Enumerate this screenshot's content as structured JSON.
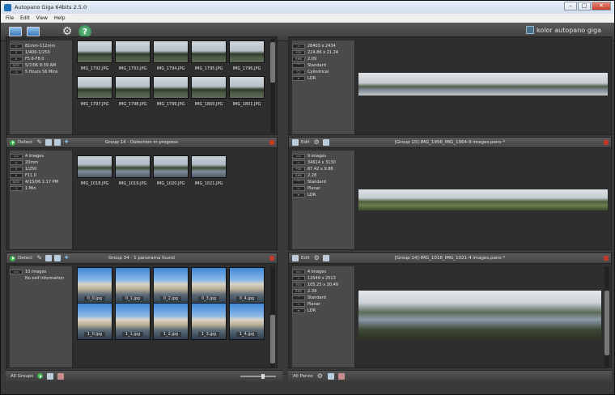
{
  "window": {
    "title": "Autopano Giga 64bits 2.5.0",
    "minimize": "–",
    "maximize": "□",
    "close": "✕"
  },
  "menu": [
    "File",
    "Edit",
    "View",
    "Help"
  ],
  "brand": "kolor autopano giga",
  "groups": [
    {
      "title": "",
      "info": [
        {
          "badge": "▭",
          "text": "81mm-112mm"
        },
        {
          "badge": "S",
          "text": "1/400-1/250"
        },
        {
          "badge": "A",
          "text": "F5.6-F8.0"
        },
        {
          "badge": "DATE",
          "text": "5/7/06 9:39 AM"
        },
        {
          "badge": "◷",
          "text": "5 Hours 56 Mins"
        }
      ],
      "thumbnails": [
        "IMG_1792.JPG",
        "IMG_1793.JPG",
        "IMG_1794.JPG",
        "IMG_1795.JPG",
        "IMG_1796.JPG",
        "IMG_1797.JPG",
        "IMG_1798.JPG",
        "IMG_1799.JPG",
        "IMG_1800.JPG",
        "IMG_1801.JPG"
      ]
    },
    {
      "title": "Group 14 - Detection in progress",
      "detect_label": "Detect",
      "info": [
        {
          "badge": "▭▭",
          "text": "4 images"
        },
        {
          "badge": "▭",
          "text": "20mm"
        },
        {
          "badge": "S",
          "text": "1/250"
        },
        {
          "badge": "A",
          "text": "F11.0"
        },
        {
          "badge": "DATE",
          "text": "4/15/06 1:17 PM"
        },
        {
          "badge": "◷",
          "text": "1 Min"
        }
      ],
      "thumbnails": [
        "IMG_1018.JPG",
        "IMG_1019.JPG",
        "IMG_1020.JPG",
        "IMG_1021.JPG"
      ]
    },
    {
      "title": "Group 34 - 1 panorama found",
      "detect_label": "Detect",
      "info": [
        {
          "badge": "▭▭",
          "text": "10 images"
        },
        {
          "badge": "",
          "text": "No exif information"
        }
      ],
      "thumbnails": [
        "0_0.jpg",
        "0_1.jpg",
        "0_2.jpg",
        "0_3.jpg",
        "0_4.jpg",
        "1_0.jpg",
        "1_1.jpg",
        "1_2.jpg",
        "1_3.jpg",
        "1_4.jpg"
      ]
    }
  ],
  "panos": [
    {
      "title": "",
      "info": [
        {
          "badge": "▭",
          "text": "26403 x 2434"
        },
        {
          "badge": "FOV",
          "text": "224.86 x 21.24"
        },
        {
          "badge": "RMS",
          "text": "2.09"
        },
        {
          "badge": "⌒",
          "text": "Standard"
        },
        {
          "badge": "◯",
          "text": "Cylindrical"
        },
        {
          "badge": "≋",
          "text": "LDR"
        }
      ]
    },
    {
      "title": "[Group 15]-IMG_1956_IMG_1964-9 images.pano *",
      "edit_label": "Edit",
      "info": [
        {
          "badge": "▭▭",
          "text": "9 images"
        },
        {
          "badge": "▭",
          "text": "34614 x 3130"
        },
        {
          "badge": "FOV",
          "text": "87.42 x 9.88"
        },
        {
          "badge": "RMS",
          "text": "2.28"
        },
        {
          "badge": "⌒",
          "text": "Standard"
        },
        {
          "badge": "▭",
          "text": "Planar"
        },
        {
          "badge": "≋",
          "text": "LDR"
        }
      ]
    },
    {
      "title": "[Group 14]-IMG_1018_IMG_1021-4 images.pano *",
      "edit_label": "Edit",
      "info": [
        {
          "badge": "▭▭",
          "text": "4 images"
        },
        {
          "badge": "▭",
          "text": "12549 x 2513"
        },
        {
          "badge": "FOV",
          "text": "105.25 x 30.49"
        },
        {
          "badge": "RMS",
          "text": "2.39"
        },
        {
          "badge": "⌒",
          "text": "Standard"
        },
        {
          "badge": "▭",
          "text": "Planar"
        },
        {
          "badge": "≋",
          "text": "LDR"
        }
      ]
    }
  ],
  "left_bottom": {
    "label": "All Groups"
  },
  "right_bottom": {
    "label": "All Panos"
  }
}
